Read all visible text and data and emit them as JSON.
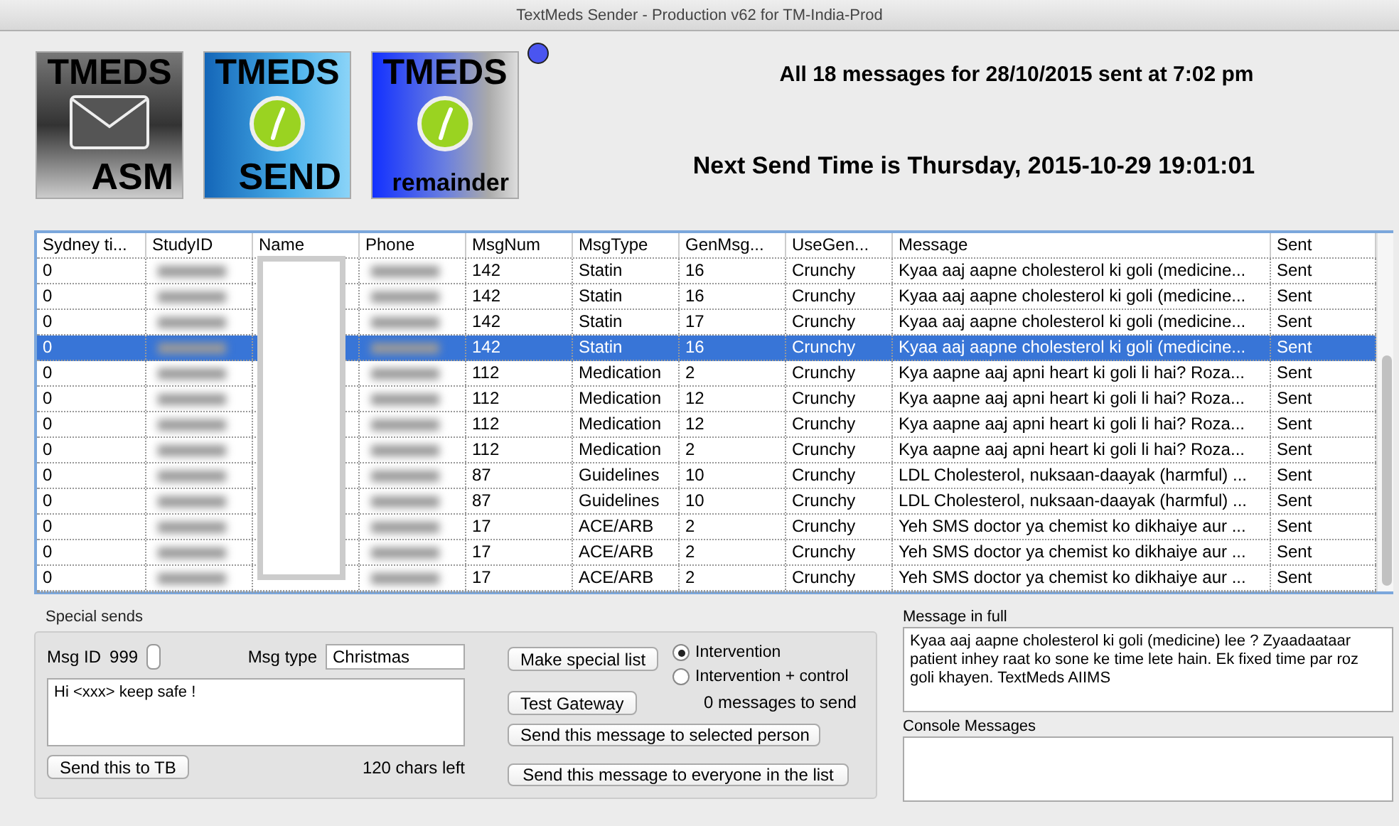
{
  "window": {
    "title": "TextMeds Sender - Production v62 for TM-India-Prod"
  },
  "app_tiles": [
    {
      "kind": "asm",
      "top": "TMEDS",
      "bottom": "ASM"
    },
    {
      "kind": "send",
      "top": "TMEDS",
      "bottom": "SEND"
    },
    {
      "kind": "remainder",
      "top": "TMEDS",
      "bottom": "remainder"
    }
  ],
  "status_dot": {
    "color": "#4a55f0"
  },
  "status_text": "All 18 messages for 28/10/2015 sent at 7:02 pm",
  "next_send": "Next Send Time is Thursday, 2015-10-29 19:01:01",
  "table": {
    "columns": [
      "Sydney ti...",
      "StudyID",
      "Name",
      "Phone",
      "MsgNum",
      "MsgType",
      "GenMsg...",
      "UseGen...",
      "Message",
      "Sent"
    ],
    "rows": [
      {
        "selected": false,
        "cells": [
          "0",
          "",
          "",
          "",
          "142",
          "Statin",
          "16",
          "Crunchy",
          "Kyaa aaj aapne cholesterol ki goli (medicine...",
          "Sent"
        ]
      },
      {
        "selected": false,
        "cells": [
          "0",
          "",
          "",
          "",
          "142",
          "Statin",
          "16",
          "Crunchy",
          "Kyaa aaj aapne cholesterol ki goli (medicine...",
          "Sent"
        ]
      },
      {
        "selected": false,
        "cells": [
          "0",
          "",
          "",
          "",
          "142",
          "Statin",
          "17",
          "Crunchy",
          "Kyaa aaj aapne cholesterol ki goli (medicine...",
          "Sent"
        ]
      },
      {
        "selected": true,
        "cells": [
          "0",
          "",
          "",
          "",
          "142",
          "Statin",
          "16",
          "Crunchy",
          "Kyaa aaj aapne cholesterol ki goli (medicine...",
          "Sent"
        ]
      },
      {
        "selected": false,
        "cells": [
          "0",
          "",
          "",
          "",
          "112",
          "Medication",
          "2",
          "Crunchy",
          "Kya aapne aaj apni heart ki goli li hai? Roza...",
          "Sent"
        ]
      },
      {
        "selected": false,
        "cells": [
          "0",
          "",
          "",
          "",
          "112",
          "Medication",
          "12",
          "Crunchy",
          "Kya aapne aaj apni heart ki goli li hai? Roza...",
          "Sent"
        ]
      },
      {
        "selected": false,
        "cells": [
          "0",
          "",
          "",
          "",
          "112",
          "Medication",
          "12",
          "Crunchy",
          "Kya aapne aaj apni heart ki goli li hai? Roza...",
          "Sent"
        ]
      },
      {
        "selected": false,
        "cells": [
          "0",
          "",
          "",
          "",
          "112",
          "Medication",
          "2",
          "Crunchy",
          "Kya aapne aaj apni heart ki goli li hai? Roza...",
          "Sent"
        ]
      },
      {
        "selected": false,
        "cells": [
          "0",
          "",
          "",
          "",
          "87",
          "Guidelines",
          "10",
          "Crunchy",
          "LDL Cholesterol, nuksaan-daayak (harmful) ...",
          "Sent"
        ]
      },
      {
        "selected": false,
        "cells": [
          "0",
          "",
          "",
          "",
          "87",
          "Guidelines",
          "10",
          "Crunchy",
          "LDL Cholesterol, nuksaan-daayak (harmful) ...",
          "Sent"
        ]
      },
      {
        "selected": false,
        "cells": [
          "0",
          "",
          "",
          "",
          "17",
          "ACE/ARB",
          "2",
          "Crunchy",
          "Yeh SMS doctor ya chemist ko dikhaiye aur ...",
          "Sent"
        ]
      },
      {
        "selected": false,
        "cells": [
          "0",
          "",
          "",
          "",
          "17",
          "ACE/ARB",
          "2",
          "Crunchy",
          "Yeh SMS doctor ya chemist ko dikhaiye aur ...",
          "Sent"
        ]
      },
      {
        "selected": false,
        "cells": [
          "0",
          "",
          "",
          "",
          "17",
          "ACE/ARB",
          "2",
          "Crunchy",
          "Yeh SMS doctor ya chemist ko dikhaiye aur ...",
          "Sent"
        ]
      }
    ]
  },
  "special_sends": {
    "title": "Special sends",
    "msg_id_label": "Msg ID",
    "msg_id": "999",
    "msg_type_label": "Msg type",
    "msg_type": "Christmas",
    "message": "Hi <xxx> keep safe !",
    "send_tb": "Send this to TB",
    "chars_left": "120 chars left",
    "make_list": "Make special list",
    "test_gateway": "Test Gateway",
    "radios": [
      {
        "label": "Intervention",
        "selected": true
      },
      {
        "label": "Intervention + control",
        "selected": false
      }
    ],
    "to_send": "0 messages to send",
    "send_selected": "Send this message to selected person",
    "send_everyone": "Send this message to everyone in the list"
  },
  "message_in_full": {
    "label": "Message in full",
    "text": "Kyaa aaj aapne cholesterol ki goli (medicine) lee ? Zyaadaataar patient inhey raat ko sone ke time lete hain. Ek fixed time par roz goli khayen. TextMeds AIIMS"
  },
  "console": {
    "label": "Console Messages"
  }
}
